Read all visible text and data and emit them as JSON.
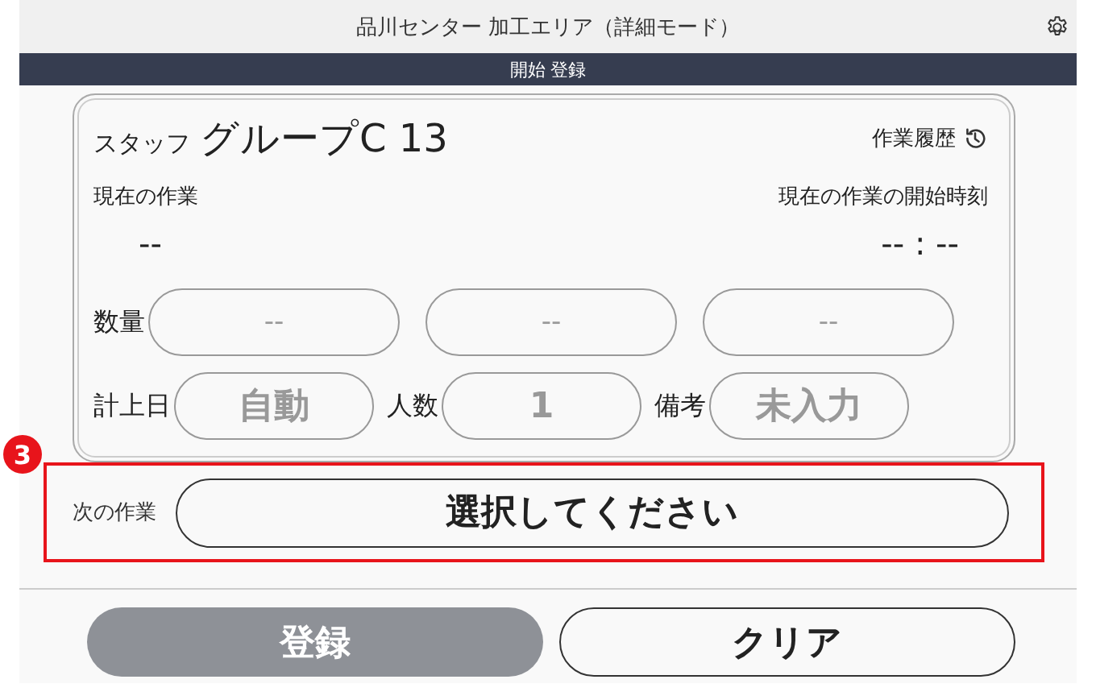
{
  "header": {
    "title": "品川センター 加工エリア（詳細モード）"
  },
  "banner": "開始 登録",
  "card": {
    "staff_label": "スタッフ",
    "staff_name": "グループC 13",
    "history_link": "作業履歴",
    "current_task_label": "現在の作業",
    "current_task_value": "--",
    "start_time_label": "現在の作業の開始時刻",
    "start_time_value": "-- : --",
    "quantity_label": "数量",
    "quantity_fields": [
      "--",
      "--",
      "--"
    ],
    "info_fields": [
      {
        "label": "計上日",
        "value": "自動"
      },
      {
        "label": "人数",
        "value": "1"
      },
      {
        "label": "備考",
        "value": "未入力"
      }
    ]
  },
  "annotation": {
    "number": "3"
  },
  "next_task": {
    "label": "次の作業",
    "value": "選択してください"
  },
  "buttons": [
    {
      "label": "登録",
      "kind": "primary",
      "disabled": true
    },
    {
      "label": "クリア",
      "kind": "secondary",
      "disabled": false
    }
  ]
}
